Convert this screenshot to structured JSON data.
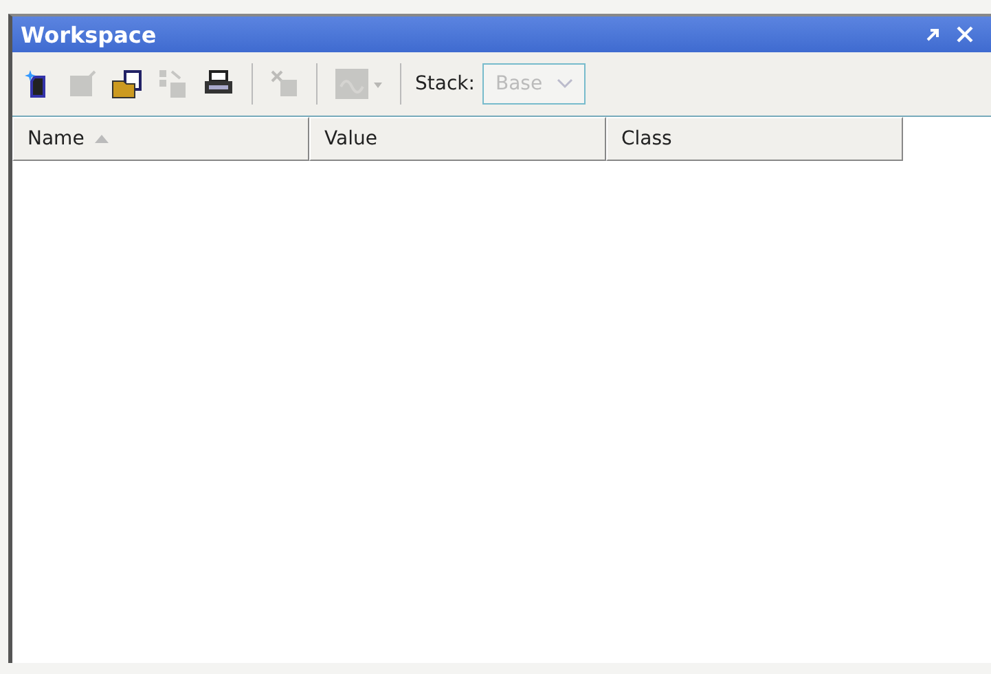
{
  "window": {
    "title": "Workspace"
  },
  "toolbar": {
    "buttons": [
      {
        "disabled": false
      },
      {
        "disabled": true
      },
      {
        "disabled": false
      },
      {
        "disabled": true
      },
      {
        "disabled": false
      },
      {
        "disabled": true
      },
      {
        "disabled": true
      }
    ],
    "stack": {
      "label": "Stack:",
      "value": "Base",
      "disabled": true
    }
  },
  "table": {
    "columns": [
      {
        "label": "Name",
        "sorted": true
      },
      {
        "label": "Value",
        "sorted": false
      },
      {
        "label": "Class",
        "sorted": false
      }
    ]
  }
}
